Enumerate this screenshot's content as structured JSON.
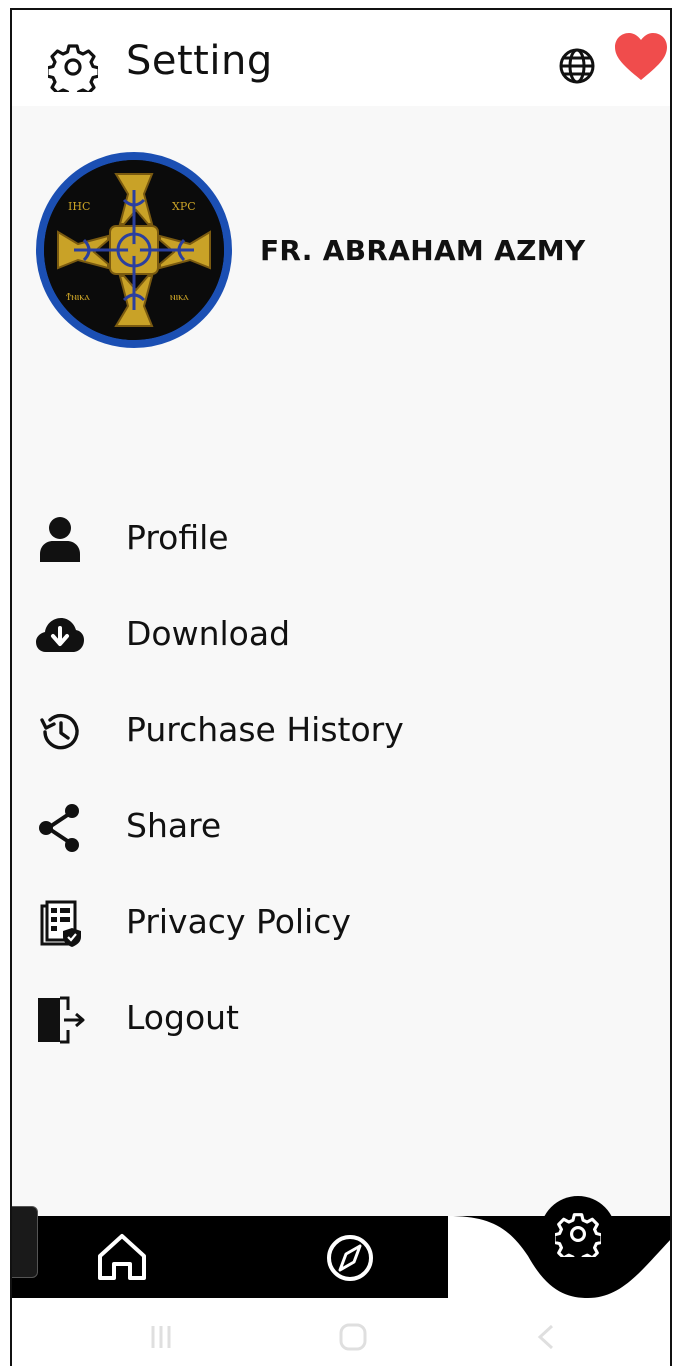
{
  "header": {
    "title": "Setting",
    "icons": [
      "gear-icon",
      "globe-icon",
      "heart-icon"
    ],
    "heart_color": "#f04c4c"
  },
  "profile": {
    "name": "FR. ABRAHAM AZMY",
    "avatar_border_color": "#1b4fb3"
  },
  "menu": {
    "items": [
      {
        "label": "Profile",
        "icon": "user-icon"
      },
      {
        "label": "Download",
        "icon": "cloud-download-icon"
      },
      {
        "label": "Purchase History",
        "icon": "history-icon"
      },
      {
        "label": "Share",
        "icon": "share-icon"
      },
      {
        "label": "Privacy Policy",
        "icon": "privacy-policy-icon"
      },
      {
        "label": "Logout",
        "icon": "logout-icon"
      }
    ]
  },
  "bottom_nav": {
    "items": [
      "home-icon",
      "compass-icon",
      "settings-icon"
    ],
    "active": "settings-icon"
  }
}
